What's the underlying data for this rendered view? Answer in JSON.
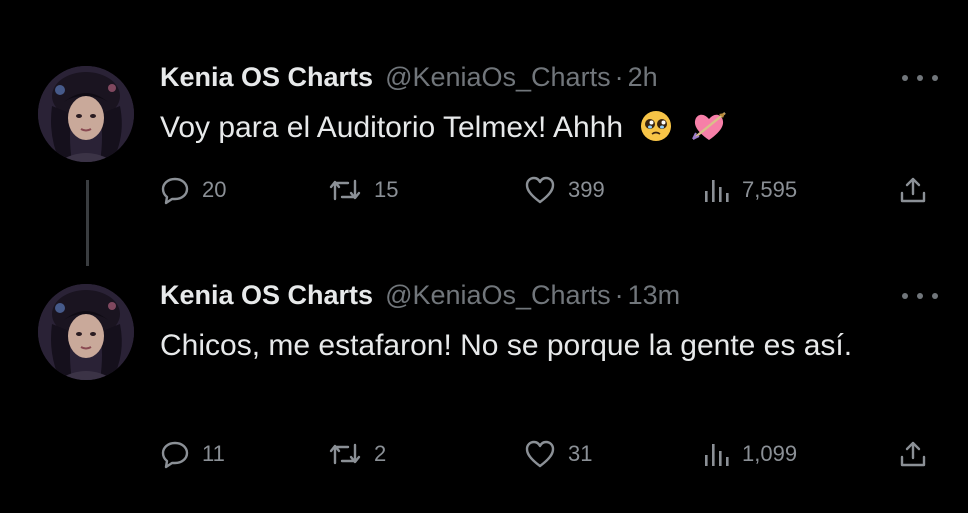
{
  "colors": {
    "background": "#000000",
    "text_primary": "#e7e9ea",
    "text_secondary": "#71767b",
    "icon": "#8b9096",
    "thread_line": "#3a3d40"
  },
  "tweets": [
    {
      "name": "Kenia OS Charts",
      "handle": "@KeniaOs_Charts",
      "separator": "·",
      "time": "2h",
      "text": "Voy para el Auditorio Telmex! Ahhh",
      "emojis": [
        "pleading-face",
        "heart-with-arrow"
      ],
      "replies": "20",
      "retweets": "15",
      "likes": "399",
      "views": "7,595"
    },
    {
      "name": "Kenia OS Charts",
      "handle": "@KeniaOs_Charts",
      "separator": "·",
      "time": "13m",
      "text": "Chicos, me estafaron! No se porque la gente es así.",
      "replies": "11",
      "retweets": "2",
      "likes": "31",
      "views": "1,099"
    }
  ]
}
